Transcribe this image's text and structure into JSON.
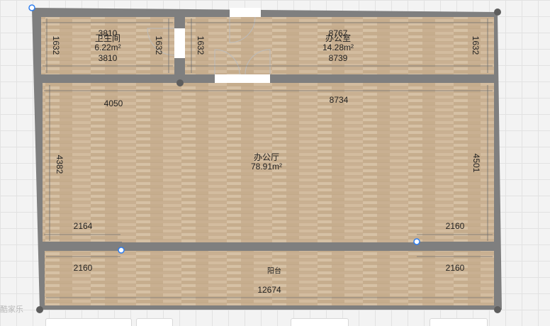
{
  "rooms": {
    "bathroom": {
      "name": "卫生间",
      "area": "6.22m²"
    },
    "office": {
      "name": "办公室",
      "area": "14.28m²"
    },
    "hall": {
      "name": "办公厅",
      "area": "78.91m²"
    },
    "balcony": {
      "name": "阳台"
    }
  },
  "dimensions": {
    "bath_top": "3810",
    "bath_bottom": "3810",
    "bath_left": "1632",
    "bath_right": "1632",
    "office_top": "8767",
    "office_bottom": "8739",
    "office_left": "1632",
    "office_right": "1632",
    "hall_top_left": "4050",
    "hall_top_right": "8734",
    "hall_left": "4382",
    "hall_right": "4501",
    "hall_bottom_left": "2164",
    "hall_bottom_right": "2160",
    "balcony_left": "2160",
    "balcony_right": "2160",
    "balcony_bottom": "12674"
  },
  "watermark": "酷家乐"
}
